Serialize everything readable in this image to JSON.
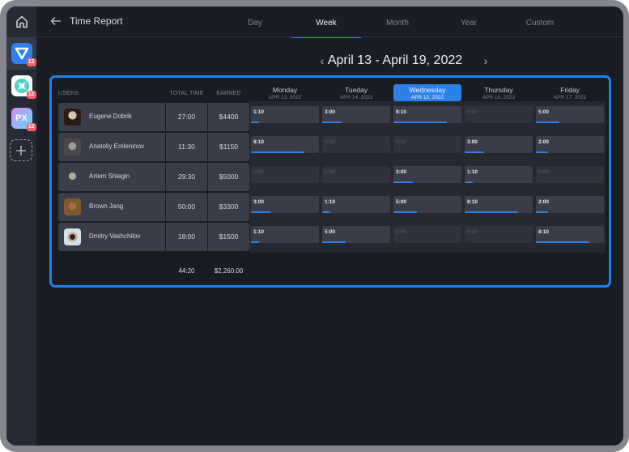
{
  "header": {
    "title": "Time Report",
    "tabs": [
      {
        "label": "Day",
        "active": false
      },
      {
        "label": "Week",
        "active": true
      },
      {
        "label": "Month",
        "active": false
      },
      {
        "label": "Year",
        "active": false
      },
      {
        "label": "Custom",
        "active": false
      }
    ]
  },
  "sidebar": {
    "apps": [
      {
        "name": "triangle-app",
        "badge": "12",
        "color": "#2f80ed"
      },
      {
        "name": "x-app",
        "badge": "12",
        "color": "#ffffff"
      },
      {
        "name": "px-app",
        "badge": "12",
        "label": "PX",
        "color": "#c58af5"
      }
    ]
  },
  "date_range": "April 13 - April 19, 2022",
  "table": {
    "headers": {
      "users": "USERS",
      "total_time": "TOTAL TIME",
      "earned": "EARNED"
    },
    "days": [
      {
        "name": "Monday",
        "date": "APR 13, 2022",
        "active": false
      },
      {
        "name": "Tueday",
        "date": "APR 14, 2022",
        "active": false
      },
      {
        "name": "Wednesday",
        "date": "APR 15, 2022",
        "active": true
      },
      {
        "name": "Thursday",
        "date": "APR 16, 2022",
        "active": false
      },
      {
        "name": "Friday",
        "date": "APR 17, 2022",
        "active": false
      }
    ],
    "rows": [
      {
        "name": "Eugene Dobrik",
        "total": "27:00",
        "earned": "$4400",
        "days": [
          {
            "v": "1:10",
            "p": 0.12
          },
          {
            "v": "3:00",
            "p": 0.28
          },
          {
            "v": "8:10",
            "p": 0.78
          },
          {
            "v": "0:00",
            "p": 0
          },
          {
            "v": "5:00",
            "p": 0.35
          }
        ]
      },
      {
        "name": "Anatoliy Emleninov",
        "total": "11:30",
        "earned": "$1150",
        "days": [
          {
            "v": "8:10",
            "p": 0.78
          },
          {
            "v": "0:00",
            "p": 0
          },
          {
            "v": "0:00",
            "p": 0
          },
          {
            "v": "3:00",
            "p": 0.28
          },
          {
            "v": "2:00",
            "p": 0.18
          }
        ]
      },
      {
        "name": "Artem Shlagin",
        "total": "29:30",
        "earned": "$5000",
        "days": [
          {
            "v": "0:00",
            "p": 0
          },
          {
            "v": "0:00",
            "p": 0
          },
          {
            "v": "3:00",
            "p": 0.28
          },
          {
            "v": "1:10",
            "p": 0.12
          },
          {
            "v": "0:00",
            "p": 0
          }
        ]
      },
      {
        "name": "Brown Jang",
        "total": "50:00",
        "earned": "$3300",
        "days": [
          {
            "v": "3:00",
            "p": 0.28
          },
          {
            "v": "1:10",
            "p": 0.12
          },
          {
            "v": "5:00",
            "p": 0.35
          },
          {
            "v": "8:10",
            "p": 0.78
          },
          {
            "v": "2:00",
            "p": 0.18
          }
        ]
      },
      {
        "name": "Dmitry Vashchilov",
        "total": "18:00",
        "earned": "$1500",
        "days": [
          {
            "v": "1:10",
            "p": 0.12
          },
          {
            "v": "5:00",
            "p": 0.35
          },
          {
            "v": "0:00",
            "p": 0
          },
          {
            "v": "0:00",
            "p": 0
          },
          {
            "v": "8:10",
            "p": 0.78
          }
        ]
      }
    ],
    "totals": {
      "total_time": "44:20",
      "earned": "$2,260.00"
    }
  }
}
